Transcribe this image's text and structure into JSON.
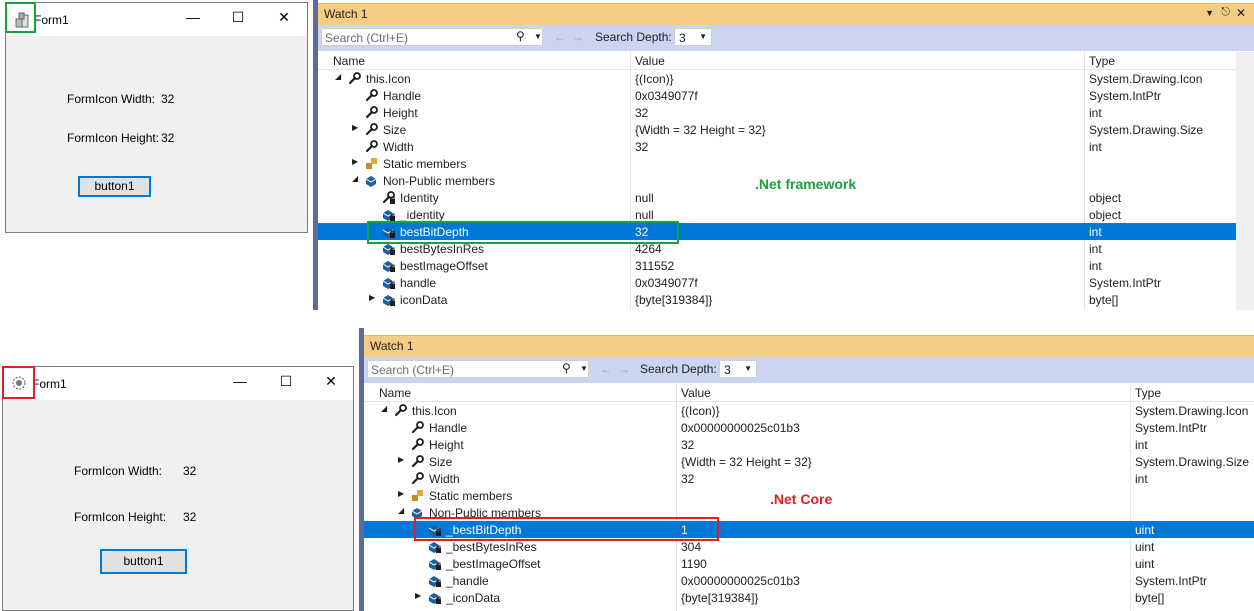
{
  "top": {
    "form": {
      "title": "Form1",
      "width_label": "FormIcon Width:",
      "width_value": "32",
      "height_label": "FormIcon Height:",
      "height_value": "32",
      "button": "button1"
    },
    "watch": {
      "title": "Watch 1",
      "search_placeholder": "Search (Ctrl+E)",
      "depth_label": "Search Depth:",
      "depth_value": "3",
      "columns": [
        "Name",
        "Value",
        "Type"
      ],
      "annotation": ".Net framework",
      "rows": [
        {
          "name": "this.Icon",
          "value": "{(Icon)}",
          "type": "System.Drawing.Icon",
          "expander": "open",
          "icon": "wrench"
        },
        {
          "name": "Handle",
          "value": "0x0349077f",
          "type": "System.IntPtr",
          "icon": "wrench"
        },
        {
          "name": "Height",
          "value": "32",
          "type": "int",
          "icon": "wrench"
        },
        {
          "name": "Size",
          "value": "{Width = 32 Height = 32}",
          "type": "System.Drawing.Size",
          "expander": "closed",
          "icon": "wrench"
        },
        {
          "name": "Width",
          "value": "32",
          "type": "int",
          "icon": "wrench"
        },
        {
          "name": "Static members",
          "value": "",
          "type": "",
          "expander": "closed",
          "icon": "static"
        },
        {
          "name": "Non-Public members",
          "value": "",
          "type": "",
          "expander": "open",
          "icon": "field"
        },
        {
          "name": "Identity",
          "value": "null",
          "type": "object",
          "icon": "wrench-lock"
        },
        {
          "name": "_identity",
          "value": "null",
          "type": "object",
          "icon": "field-lock"
        },
        {
          "name": "bestBitDepth",
          "value": "32",
          "type": "int",
          "icon": "field-lock",
          "selected": true
        },
        {
          "name": "bestBytesInRes",
          "value": "4264",
          "type": "int",
          "icon": "field-lock"
        },
        {
          "name": "bestImageOffset",
          "value": "311552",
          "type": "int",
          "icon": "field-lock"
        },
        {
          "name": "handle",
          "value": "0x0349077f",
          "type": "System.IntPtr",
          "icon": "field-lock"
        },
        {
          "name": "iconData",
          "value": "{byte[319384]}",
          "type": "byte[]",
          "expander": "closed",
          "icon": "field-lock"
        }
      ]
    }
  },
  "bottom": {
    "form": {
      "title": "Form1",
      "width_label": "FormIcon Width:",
      "width_value": "32",
      "height_label": "FormIcon Height:",
      "height_value": "32",
      "button": "button1"
    },
    "watch": {
      "title": "Watch 1",
      "search_placeholder": "Search (Ctrl+E)",
      "depth_label": "Search Depth:",
      "depth_value": "3",
      "columns": [
        "Name",
        "Value",
        "Type"
      ],
      "annotation": ".Net Core",
      "rows": [
        {
          "name": "this.Icon",
          "value": "{(Icon)}",
          "type": "System.Drawing.Icon",
          "expander": "open",
          "icon": "wrench"
        },
        {
          "name": "Handle",
          "value": "0x00000000025c01b3",
          "type": "System.IntPtr",
          "icon": "wrench"
        },
        {
          "name": "Height",
          "value": "32",
          "type": "int",
          "icon": "wrench"
        },
        {
          "name": "Size",
          "value": "{Width = 32 Height = 32}",
          "type": "System.Drawing.Size",
          "expander": "closed",
          "icon": "wrench"
        },
        {
          "name": "Width",
          "value": "32",
          "type": "int",
          "icon": "wrench"
        },
        {
          "name": "Static members",
          "value": "",
          "type": "",
          "expander": "closed",
          "icon": "static"
        },
        {
          "name": "Non-Public members",
          "value": "",
          "type": "",
          "expander": "open",
          "icon": "field"
        },
        {
          "name": "_bestBitDepth",
          "value": "1",
          "type": "uint",
          "icon": "field-lock",
          "selected": true
        },
        {
          "name": "_bestBytesInRes",
          "value": "304",
          "type": "uint",
          "icon": "field-lock"
        },
        {
          "name": "_bestImageOffset",
          "value": "1190",
          "type": "uint",
          "icon": "field-lock"
        },
        {
          "name": "_handle",
          "value": "0x00000000025c01b3",
          "type": "System.IntPtr",
          "icon": "field-lock"
        },
        {
          "name": "_iconData",
          "value": "{byte[319384]}",
          "type": "byte[]",
          "expander": "closed",
          "icon": "field-lock"
        }
      ]
    }
  },
  "colors": {
    "framework_highlight": "#1aa33a",
    "core_highlight": "#e02020",
    "selection": "#0078d7",
    "watch_header": "#f5cc84",
    "toolbar": "#ccd5f0"
  }
}
